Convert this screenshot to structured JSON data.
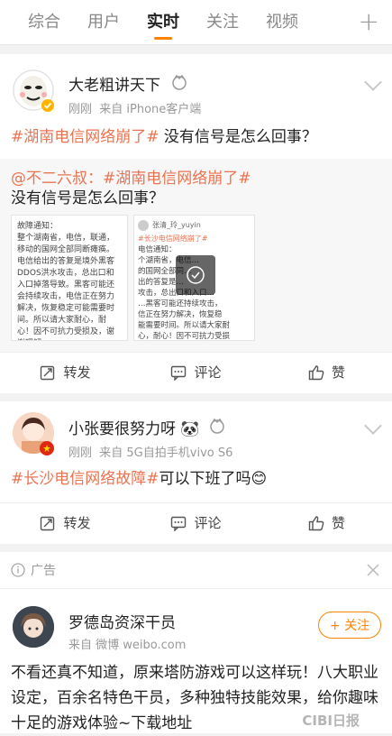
{
  "nav": {
    "tabs": [
      "综合",
      "用户",
      "实时",
      "关注",
      "视频"
    ],
    "active_tab": "实时",
    "plus": "+"
  },
  "post1": {
    "author": "大老粗讲天下",
    "time": "刚刚",
    "source": "来自 iPhone客户端",
    "hashtag": "#湖南电信网络崩了#",
    "text": " 没有信号是怎么回事？",
    "repost": {
      "mention": "@不二六叔",
      "separator": "：",
      "hashtag": "#湖南电信网络崩了#",
      "text": "没有信号是怎么回事？",
      "image1_text": "故障通知：\n整个湖南省，电信，联通，移动的国网全部同断瘫痪。电信给出的答复是境外黑客DDOS洪水攻击，总出口和入口掉落导致。黑客可能还会持续攻击，电信正在努力解决，恢复稳定可能需要时间。所以请大家耐心，耐心！因不可抗力受损及，谢谢理解",
      "image2_header": "张清_玲_yuyin",
      "image2_sub": "#长沙电信网络崩了#",
      "image2_text": "电信通知：\n个湖南省，电信…\n的国网全部同…\n出的答复是…\n攻击，总出口和入口…\n…黑客可能还持续攻击，\n信正在努力解决，恢复稳\n能需要时间。所以请大家耐\n心，耐心！因不可抗力受损"
    },
    "actions": {
      "repost": "转发",
      "comment": "评论",
      "like": "赞"
    }
  },
  "post2": {
    "author": "小张要很努力呀",
    "author_emoji": "🐼",
    "time": "刚刚",
    "source": "来自 5G自拍手机vivo S6",
    "hashtag": "#长沙电信网络故障#",
    "text": "可以下班了吗",
    "emoji": "😊",
    "actions": {
      "repost": "转发",
      "comment": "评论",
      "like": "赞"
    }
  },
  "ad": {
    "label": "广告",
    "author": "罗德岛资深干员",
    "source": "来自 微博 weibo.com",
    "follow": "+ 关注",
    "text": "不看还真不知道，原来塔防游戏可以这样玩！八大职业设定，百余名特色干员，多种独特技能效果，给你趣味十足的游戏体验~下载地址",
    "watermark": "CIBI日报"
  },
  "colors": {
    "accent": "#ff8200",
    "link": "#eb7350"
  }
}
